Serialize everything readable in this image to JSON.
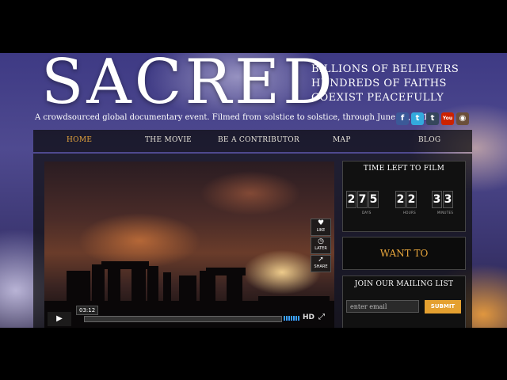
{
  "header": {
    "logo": "SACRED",
    "tagline": [
      "BILLIONS OF BELIEVERS",
      "HUNDREDS OF FAITHS",
      "COEXIST PEACEFULLY"
    ],
    "subtitle": "A crowdsourced global documentary event. Filmed from solstice to solstice, through June 21, 2014."
  },
  "social": [
    {
      "name": "facebook-icon",
      "glyph": "f",
      "color": "#3b5998"
    },
    {
      "name": "twitter-icon",
      "glyph": "t",
      "color": "#33aadd"
    },
    {
      "name": "tumblr-icon",
      "glyph": "t",
      "color": "#35465c"
    },
    {
      "name": "youtube-icon",
      "glyph": "You",
      "color": "#cc2200"
    },
    {
      "name": "instagram-icon",
      "glyph": "◉",
      "color": "#6b4f3a"
    }
  ],
  "nav": {
    "home": "HOME",
    "movie": "THE MOVIE",
    "contributor": "BE A CONTRIBUTOR",
    "map": "MAP",
    "blog": "BLOG",
    "active_color": "#e8a63c"
  },
  "video": {
    "like": "LIKE",
    "later": "LATER",
    "share": "SHARE",
    "time": "03:12",
    "hd": "HD"
  },
  "countdown": {
    "title": "TIME LEFT TO FILM",
    "days": [
      "2",
      "7",
      "5"
    ],
    "hours": [
      "2",
      "2"
    ],
    "minutes": [
      "3",
      "3"
    ],
    "days_label": "DAYS",
    "hours_label": "HOURS",
    "minutes_label": "MINUTES"
  },
  "contribute": "WANT TO CONTRIBUTE?",
  "mailing": {
    "title": "JOIN OUR MAILING LIST",
    "placeholder": "enter email",
    "submit": "SUBMIT"
  }
}
